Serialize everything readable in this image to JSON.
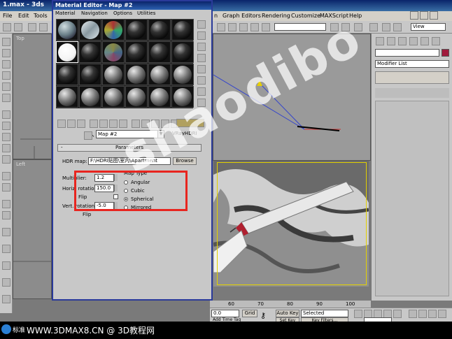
{
  "max_window": {
    "title": "1.max - 3ds",
    "menu": [
      "File",
      "Edit",
      "Tools",
      "n",
      "Graph Editors",
      "Rendering",
      "Customize",
      "MAXScript",
      "Help"
    ],
    "view_combo": "View",
    "viewport_top": "Top",
    "viewport_left": "Left"
  },
  "command_panel": {
    "modifier_list": "Modifier List"
  },
  "material_editor": {
    "title": "Material Editor - Map #2",
    "menu": [
      "Material",
      "Navigation",
      "Options",
      "Utilities"
    ],
    "map_name": "Map #2",
    "map_type": "VRayHDRI",
    "rollout_title": "Parameters",
    "rollout_sign": "-",
    "hdr_map_label": "HDR map:",
    "hdr_map_value": "F:\\HDRI贴图\\室内\\Apartment",
    "browse_label": "Browse",
    "multiplier_label": "Multiplier:",
    "multiplier_value": "1.2",
    "horiz_rotation_label": "Horiz. rotation:",
    "horiz_rotation_value": "150.0",
    "flip_label": "Flip",
    "vert_rotation_label": "Vert. rotation:",
    "vert_rotation_value": "-5.0",
    "flip2_label": "Flip",
    "map_type_group": "Map Type",
    "map_types": [
      "Angular",
      "Cubic",
      "Spherical",
      "Mirrored"
    ],
    "selected_map_type": "Spherical"
  },
  "timeline": {
    "ticks": [
      "60",
      "70",
      "80",
      "90",
      "100"
    ],
    "coord_value": "0.0",
    "grid_label": "Grid",
    "auto_key_label": "Auto Key",
    "selected_combo": "Selected",
    "set_key_label": "Set Key",
    "key_filters_label": "Key Filters...",
    "add_time_tag": "Add Time Tag"
  },
  "taskbar": {
    "start_label": "标准",
    "watermark_url": "WWW.3DMAX8.CN @ 3D教程网"
  },
  "watermark": {
    "text": "shaodibo"
  }
}
